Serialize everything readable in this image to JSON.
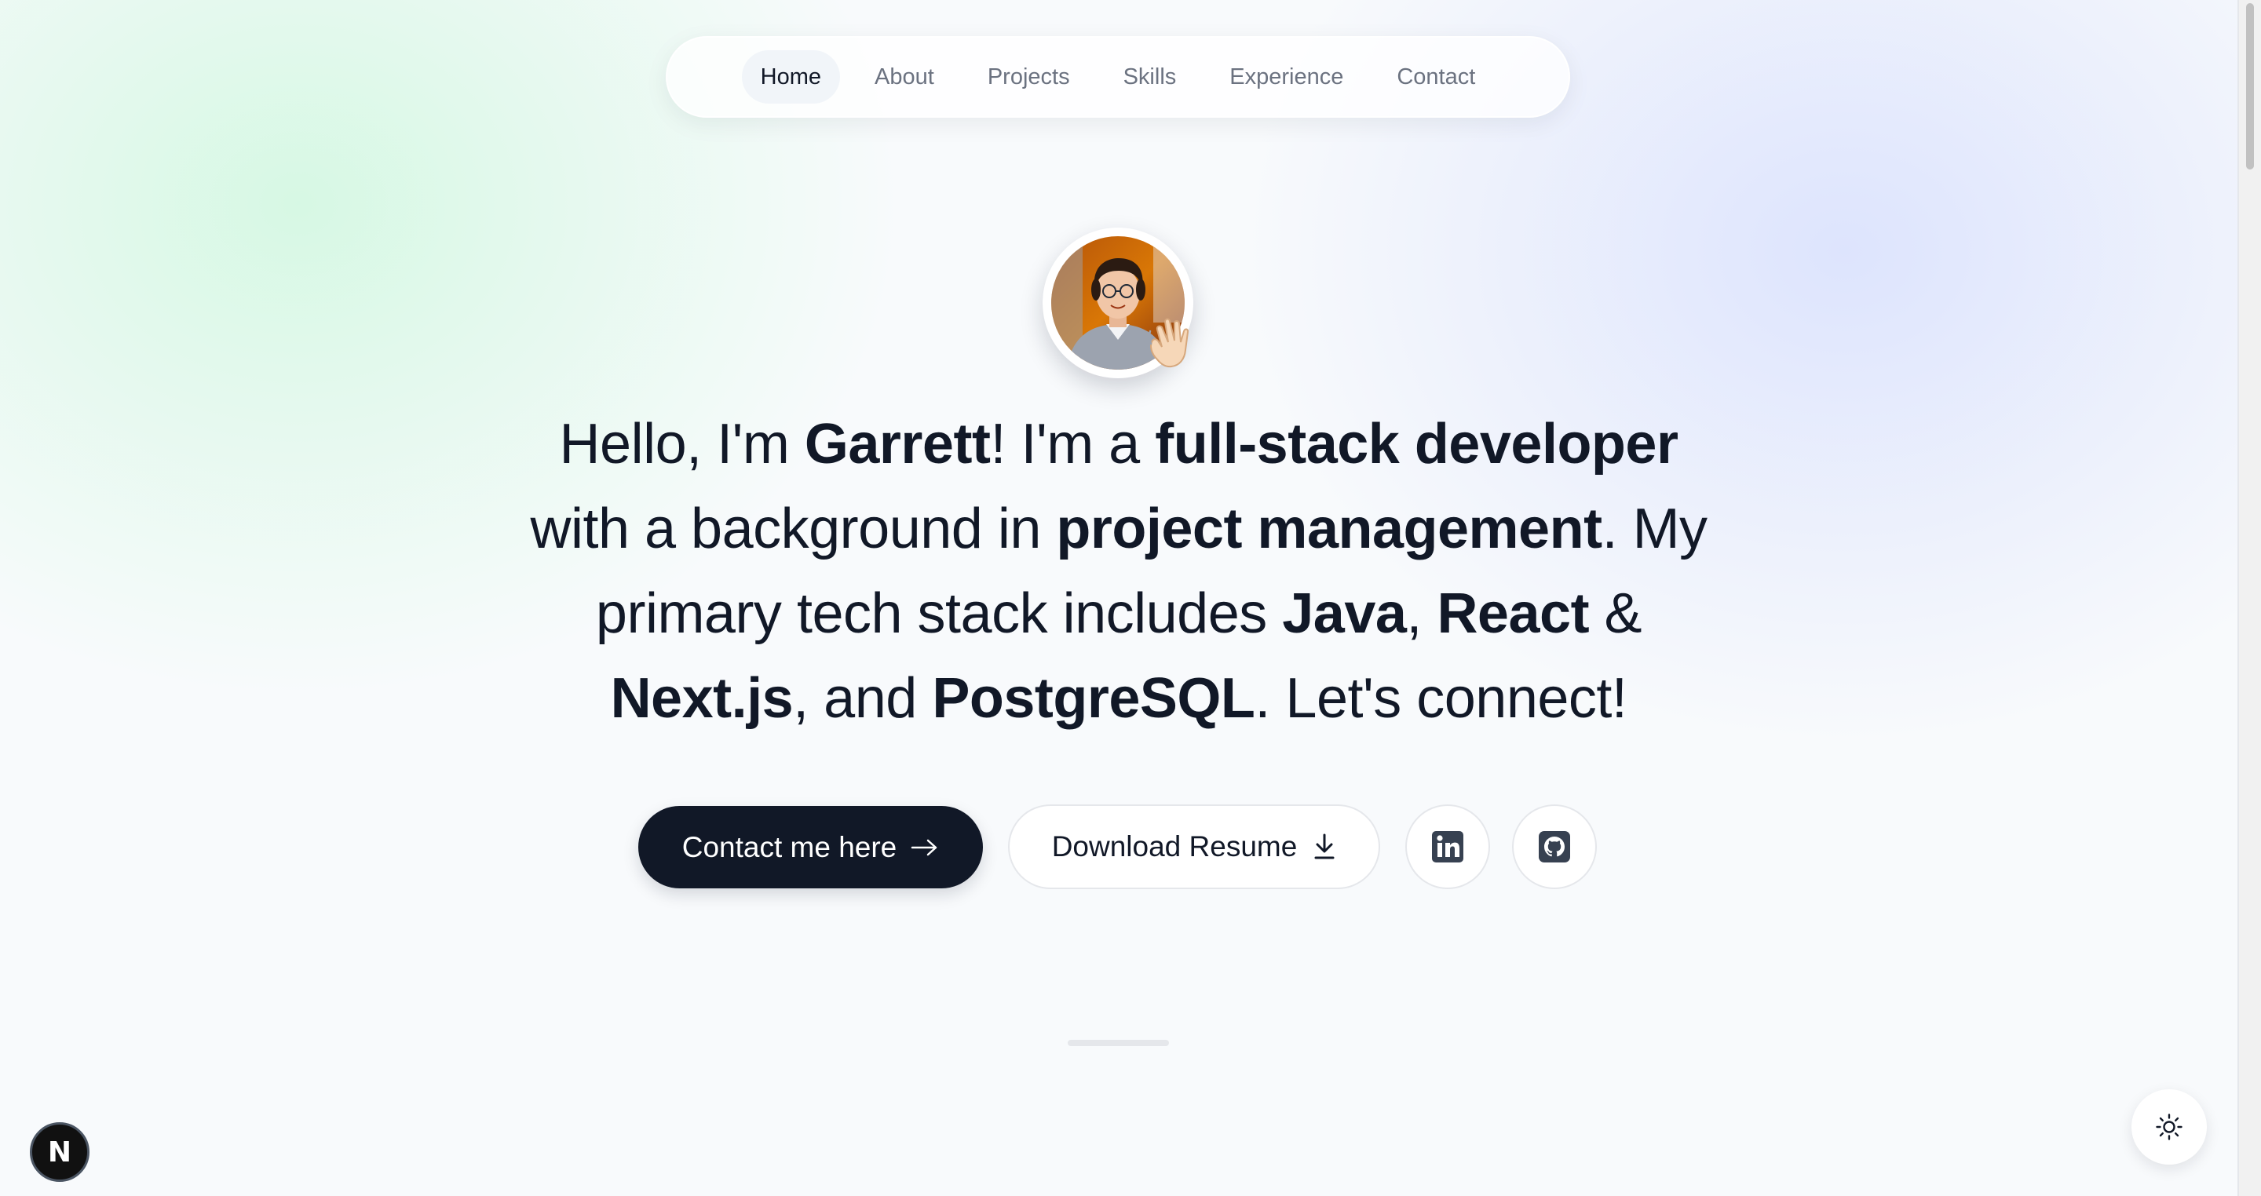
{
  "nav": {
    "items": [
      {
        "label": "Home",
        "active": true
      },
      {
        "label": "About",
        "active": false
      },
      {
        "label": "Projects",
        "active": false
      },
      {
        "label": "Skills",
        "active": false
      },
      {
        "label": "Experience",
        "active": false
      },
      {
        "label": "Contact",
        "active": false
      }
    ]
  },
  "hero": {
    "avatar_alt": "Profile photo",
    "wave_icon": "waving-hand",
    "headline": {
      "p1": "Hello, I'm ",
      "name": "Garrett",
      "p2": "! I'm a ",
      "role": "full-stack developer",
      "p3": " with a background in ",
      "background": "project management",
      "p4": ". My primary tech stack includes ",
      "tech1": "Java",
      "p5": ", ",
      "tech2": "React",
      "p6": " & ",
      "tech3": "Next.js",
      "p7": ", and ",
      "tech4": "PostgreSQL",
      "p8": ". Let's connect!"
    },
    "contact_button_label": "Contact me here",
    "resume_button_label": "Download Resume",
    "social_icons": [
      "linkedin-icon",
      "github-icon"
    ]
  },
  "widgets": {
    "next_badge_letter": "N",
    "theme_icon": "sun-icon"
  },
  "colors": {
    "primary_dark": "#111827",
    "muted_text": "#6b7280",
    "accent_green": "#bbf7d0",
    "accent_indigo": "#c7d2fe"
  }
}
